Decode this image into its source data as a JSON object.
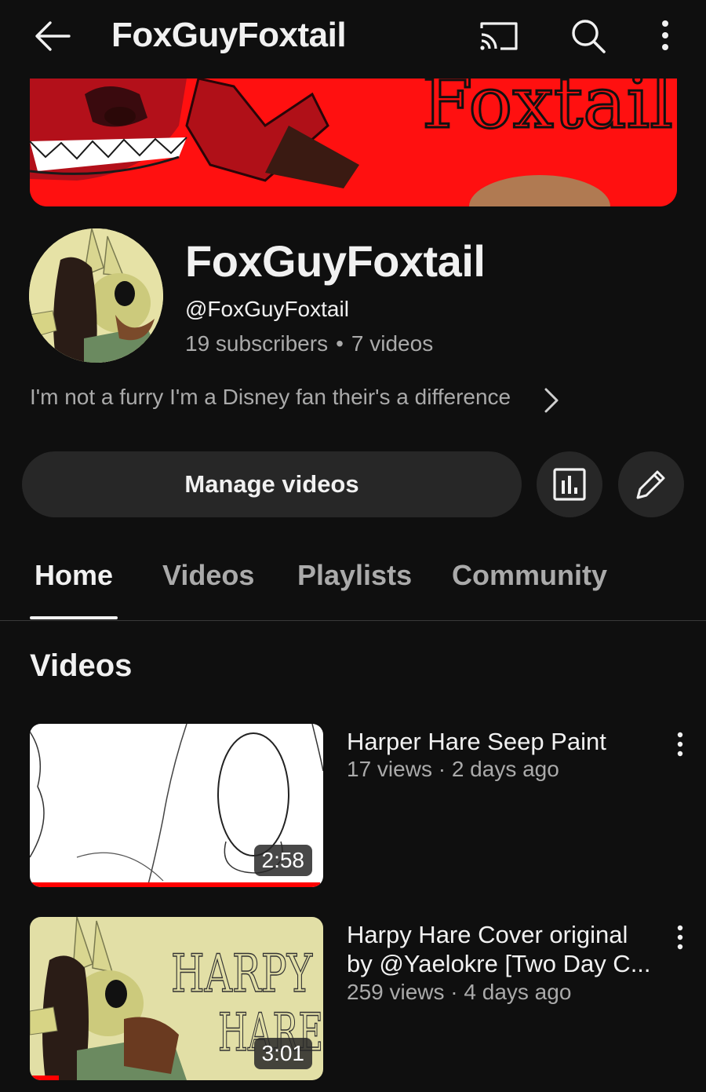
{
  "header": {
    "title": "FoxGuyFoxtail",
    "back_icon": "arrow-left-icon",
    "cast_icon": "cast-icon",
    "search_icon": "search-icon",
    "more_icon": "more-vertical-icon"
  },
  "banner": {
    "text": "Foxtail"
  },
  "channel": {
    "name": "FoxGuyFoxtail",
    "handle": "@FoxGuyFoxtail",
    "subscribers": "19 subscribers",
    "separator": "•",
    "video_count": "7 videos",
    "description": "I'm not a furry I'm a Disney fan their's a difference"
  },
  "actions": {
    "manage_label": "Manage videos",
    "stats_icon": "analytics-icon",
    "edit_icon": "pencil-icon"
  },
  "tabs": [
    {
      "label": "Home",
      "active": true
    },
    {
      "label": "Videos",
      "active": false
    },
    {
      "label": "Playlists",
      "active": false
    },
    {
      "label": "Community",
      "active": false
    }
  ],
  "section": {
    "title": "Videos"
  },
  "videos": [
    {
      "title": "Harper Hare Seep Paint",
      "meta": "17 views · 2 days ago",
      "duration": "2:58",
      "watched_fraction": 0.99
    },
    {
      "title": "Harpy Hare Cover original by @Yaelokre [Two Day C...",
      "meta": "259 views · 4 days ago",
      "duration": "3:01",
      "watched_fraction": 0.1,
      "thumb_text_1": "HARPY",
      "thumb_text_2": "HARE"
    }
  ],
  "colors": {
    "background": "#0f0f0f",
    "button_bg": "#272727",
    "secondary_text": "#aaaaaa",
    "progress": "#ff0000",
    "banner_red": "#ff1010"
  }
}
